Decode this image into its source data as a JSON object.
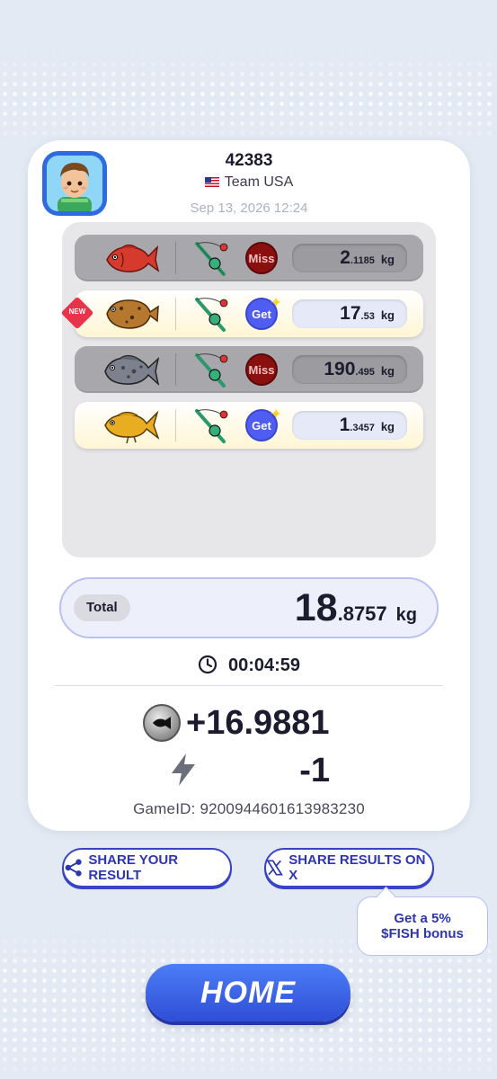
{
  "player": {
    "name": "42383",
    "team": "Team USA",
    "date": "Sep 13, 2026 12:24"
  },
  "catches": [
    {
      "result": "Miss",
      "weight_int": "2",
      "weight_dec": ".1185",
      "unit": "kg",
      "fish": "red-snapper",
      "fish_color": "#d63a2c",
      "is_new": false
    },
    {
      "result": "Get",
      "weight_int": "17",
      "weight_dec": ".53",
      "unit": "kg",
      "fish": "flounder",
      "fish_color": "#a86a2a",
      "is_new": true,
      "new_label": "NEW"
    },
    {
      "result": "Miss",
      "weight_int": "190",
      "weight_dec": ".495",
      "unit": "kg",
      "fish": "grouper",
      "fish_color": "#6f7480",
      "is_new": false
    },
    {
      "result": "Get",
      "weight_int": "1",
      "weight_dec": ".3457",
      "unit": "kg",
      "fish": "carp",
      "fish_color": "#e3a81e",
      "is_new": false
    }
  ],
  "total": {
    "label": "Total",
    "int": "18",
    "dec": ".8757",
    "unit": "kg"
  },
  "timer": "00:04:59",
  "reward": "+16.9881",
  "energy": "-1",
  "game_id": "GameID: 9200944601613983230",
  "buttons": {
    "share_result": "SHARE YOUR RESULT",
    "share_x": "SHARE RESULTS ON X",
    "home": "HOME"
  },
  "tooltip": {
    "line1": "Get a 5%",
    "line2": "$FISH bonus"
  },
  "colors": {
    "accent": "#3844c8",
    "miss_badge": "#8a1010",
    "get_badge": "#4f5df0",
    "background": "#e3eaf4"
  }
}
